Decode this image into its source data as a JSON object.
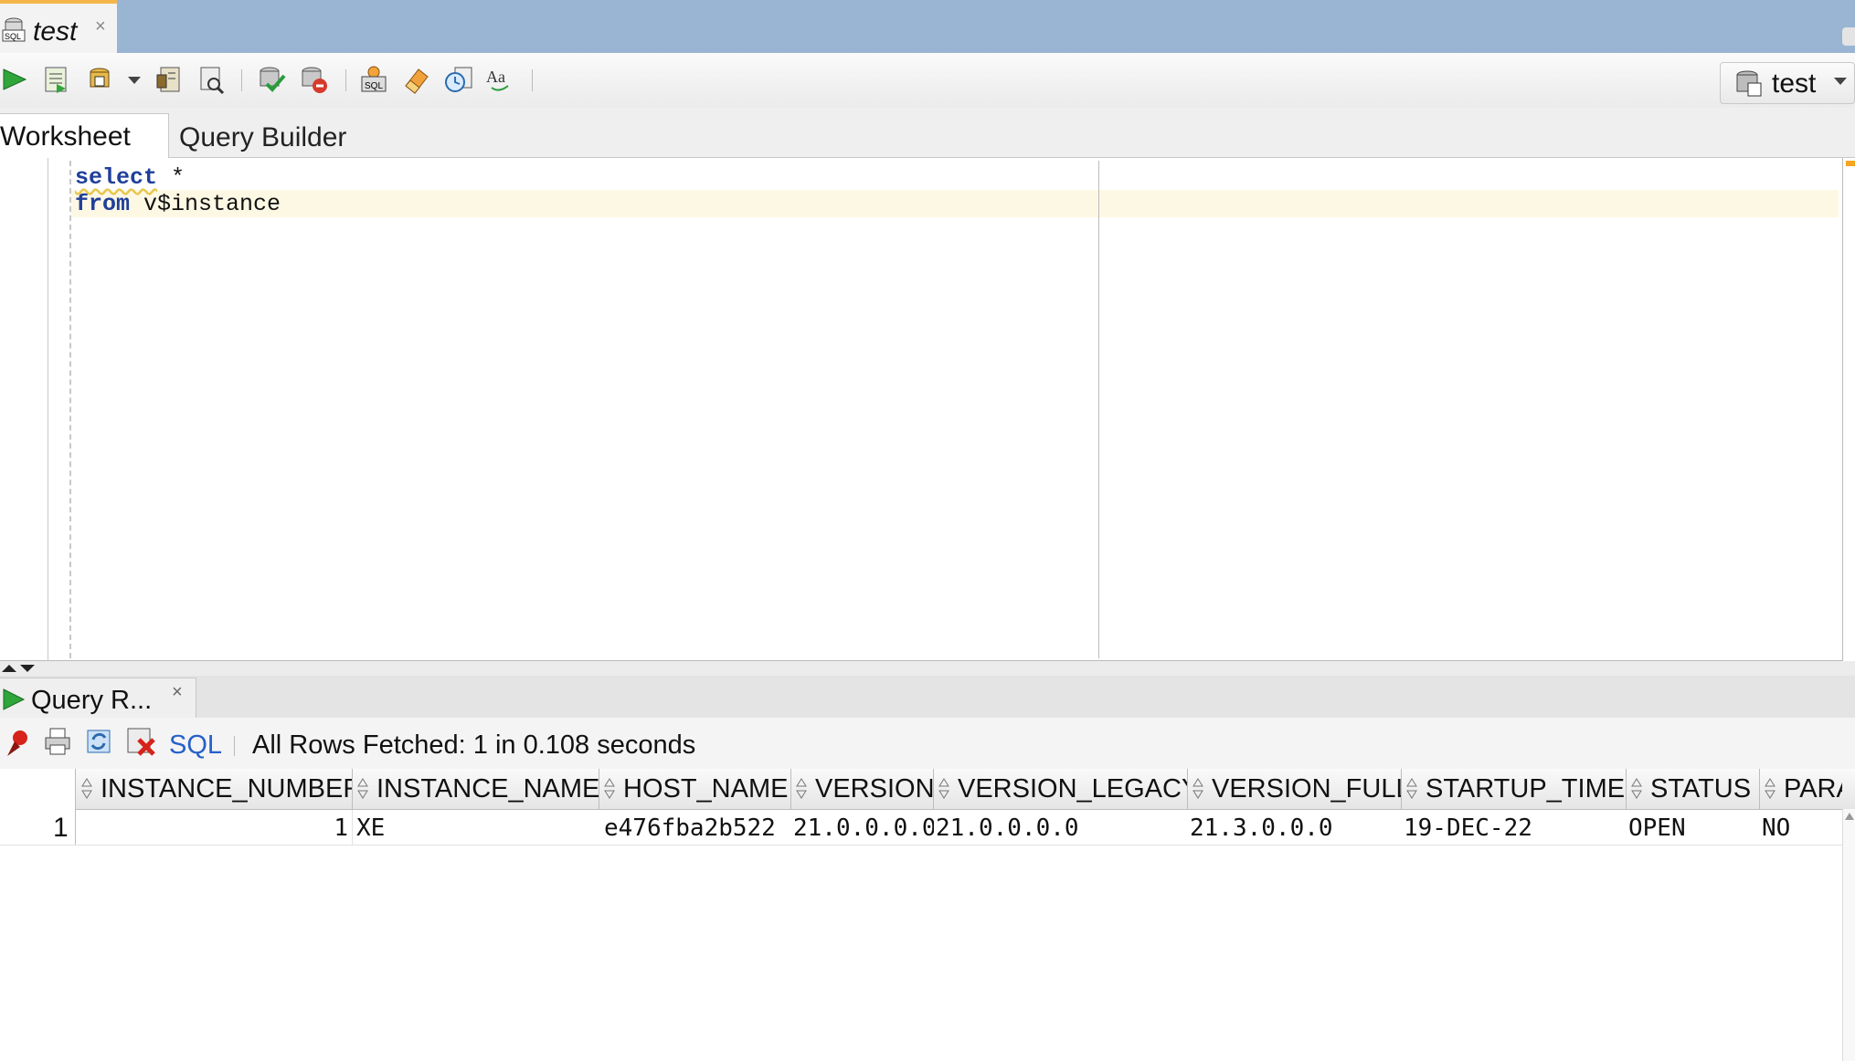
{
  "window": {
    "doc_tab": {
      "label": "test",
      "close": "×"
    }
  },
  "toolbar": {
    "icons": [
      "run-statement-icon",
      "run-script-icon",
      "autotrace-icon",
      "dropdown-arrow-icon",
      "explain-plan-icon",
      "sql-tuning-icon",
      "commit-icon",
      "rollback-icon",
      "unshared-sql-icon",
      "clear-eraser-icon",
      "sql-history-icon",
      "format-text-icon"
    ],
    "connection": {
      "label": "test"
    }
  },
  "subtabs": {
    "worksheet": "Worksheet",
    "query_builder": "Query Builder"
  },
  "editor": {
    "line1": {
      "keyword": "select",
      "rest": " *"
    },
    "line2": {
      "keyword": "from",
      "rest": " v$instance"
    }
  },
  "results": {
    "tab_label": "Query R...",
    "tab_close": "×",
    "sql_label": "SQL",
    "status": "All Rows Fetched: 1 in 0.108 seconds",
    "columns": [
      "INSTANCE_NUMBER",
      "INSTANCE_NAME",
      "HOST_NAME",
      "VERSION",
      "VERSION_LEGACY",
      "VERSION_FULL",
      "STARTUP_TIME",
      "STATUS",
      "PARA"
    ],
    "rows": [
      {
        "num": "1",
        "cells": [
          "1",
          "XE",
          "e476fba2b522",
          "21.0.0.0.0",
          "21.0.0.0.0",
          "21.3.0.0.0",
          "19-DEC-22",
          "OPEN",
          "NO"
        ]
      }
    ]
  },
  "colors": {
    "tab_strip": "#9ab4d3",
    "keyword": "#1f3f9a",
    "link": "#2561c9",
    "active_tab_accent": "#f4b64a",
    "current_line": "#fdf8e4"
  }
}
